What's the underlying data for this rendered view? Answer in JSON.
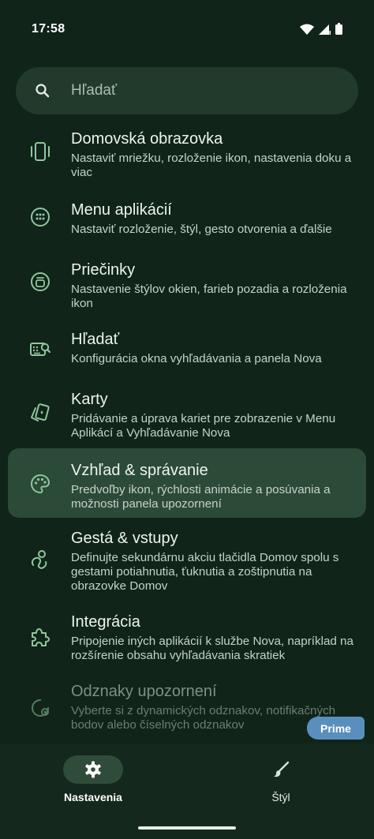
{
  "status_bar": {
    "time": "17:58"
  },
  "search": {
    "placeholder": "Hľadať"
  },
  "settings": [
    {
      "title": "Domovská obrazovka",
      "desc": "Nastaviť mriežku, rozloženie ikon, nastavenia doku a viac",
      "icon": "phone-icon"
    },
    {
      "title": "Menu aplikácií",
      "desc": "Nastaviť rozloženie, štýl, gesto otvorenia a ďalšie",
      "icon": "app-grid-icon"
    },
    {
      "title": "Priečinky",
      "desc": "Nastavenie štýlov okien, farieb pozadia a rozloženia ikon",
      "icon": "folder-icon"
    },
    {
      "title": "Hľadať",
      "desc": "Konfigurácia okna vyhľadávania a panela Nova",
      "icon": "search-keyboard-icon"
    },
    {
      "title": "Karty",
      "desc": "Pridávanie a úprava kariet pre zobrazenie v Menu Aplikácí a Vyhľadávanie Nova",
      "icon": "cards-icon"
    },
    {
      "title": "Vzhľad & správanie",
      "desc": "Predvoľby ikon, rýchlosti animácie a posúvania a možnosti panela upozornení",
      "icon": "palette-icon",
      "selected": true
    },
    {
      "title": "Gestá & vstupy",
      "desc": "Definujte sekundárnu akciu tlačidla Domov spolu s gestami potiahnutia, ťuknutia a zoštipnutia na obrazovke Domov",
      "icon": "gesture-icon"
    },
    {
      "title": "Integrácia",
      "desc": "Pripojenie iných aplikácií k službe Nova, napríklad na rozšírenie obsahu vyhľadávania skratiek",
      "icon": "puzzle-icon"
    },
    {
      "title": "Odznaky upozornení",
      "desc": "Vyberte si z dynamických odznakov, notifikačných bodov alebo číselných odznakov",
      "icon": "badge-icon",
      "disabled": true
    }
  ],
  "prime_badge": "Prime",
  "bottom_nav": [
    {
      "label": "Nastavenia",
      "icon": "gear-icon",
      "active": true
    },
    {
      "label": "Štýl",
      "icon": "brush-icon",
      "active": false
    }
  ],
  "colors": {
    "accent_icon": "#8fc79c",
    "selected_bg": "#2b4a37",
    "prime": "#5a8fbd"
  }
}
